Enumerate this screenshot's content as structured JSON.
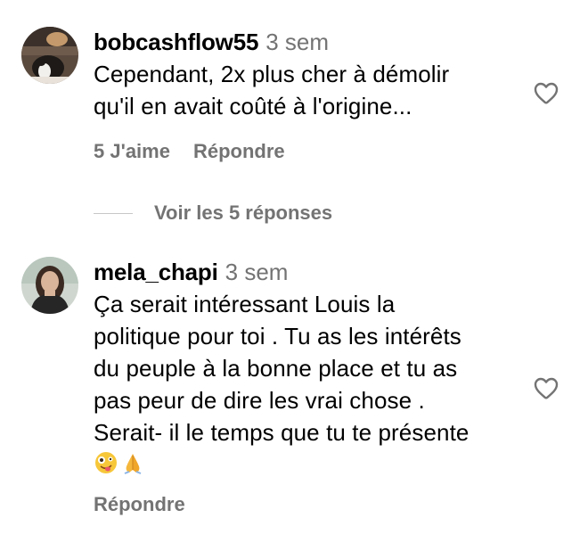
{
  "comments": [
    {
      "username": "bobcashflow55",
      "time": "3 sem",
      "text_lines": [
        "Cependant, 2x plus cher à démolir",
        "qu'il en avait coûté à l'origine..."
      ],
      "likes_label": "5 J'aime",
      "reply_label": "Répondre",
      "replies_toggle": "Voir les 5 réponses"
    },
    {
      "username": "mela_chapi",
      "time": "3 sem",
      "text_lines": [
        "Ça serait intéressant Louis la",
        "politique pour toi . Tu as les intérêts",
        "du peuple à la bonne place et tu as",
        "pas peur de dire les vrai chose .",
        "Serait- il le temps que tu te présente"
      ],
      "emojis": [
        "zany-face-emoji",
        "folded-hands-emoji"
      ],
      "reply_label": "Répondre"
    }
  ],
  "colors": {
    "text": "#000000",
    "secondary": "#737373",
    "divider": "#c7c7c7"
  }
}
